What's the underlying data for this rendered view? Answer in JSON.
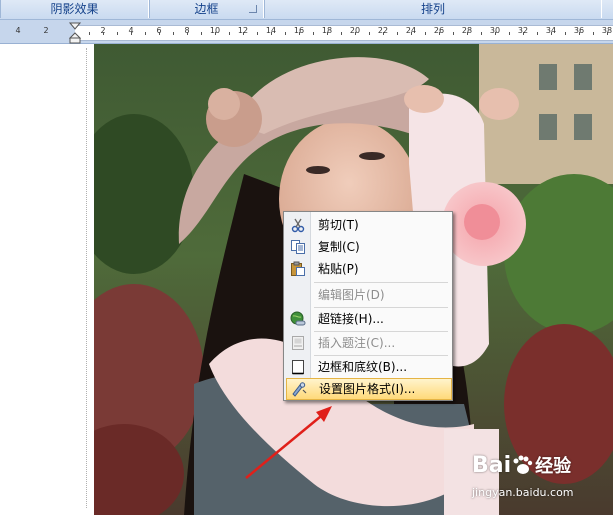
{
  "ribbon": {
    "groups": [
      {
        "label": "阴影效果"
      },
      {
        "label": "边框"
      },
      {
        "label": "排列"
      }
    ]
  },
  "ruler": {
    "numbers": [
      "4",
      "2",
      "2",
      "4",
      "6",
      "8",
      "10",
      "12",
      "14",
      "16",
      "18",
      "20",
      "22",
      "24",
      "26",
      "28",
      "30",
      "32",
      "34",
      "36",
      "38"
    ]
  },
  "context_menu": {
    "items": [
      {
        "label": "剪切(T)",
        "icon": "scissors-icon",
        "enabled": true
      },
      {
        "label": "复制(C)",
        "icon": "copy-icon",
        "enabled": true
      },
      {
        "label": "粘贴(P)",
        "icon": "paste-icon",
        "enabled": true
      },
      {
        "label": "编辑图片(D)",
        "icon": "",
        "enabled": false
      },
      {
        "label": "超链接(H)...",
        "icon": "hyperlink-globe-icon",
        "enabled": true
      },
      {
        "label": "插入题注(C)...",
        "icon": "caption-icon",
        "enabled": false
      },
      {
        "label": "边框和底纹(B)...",
        "icon": "border-page-icon",
        "enabled": true
      },
      {
        "label": "设置图片格式(I)...",
        "icon": "format-picture-icon",
        "enabled": true,
        "highlighted": true
      }
    ]
  },
  "watermark": {
    "logo": "Bai",
    "logo_cn": "经验",
    "url": "jingyan.baidu.com"
  },
  "colors": {
    "ribbon_text": "#15428b",
    "menu_highlight": "#ffd97a",
    "arrow": "#e0201a"
  }
}
